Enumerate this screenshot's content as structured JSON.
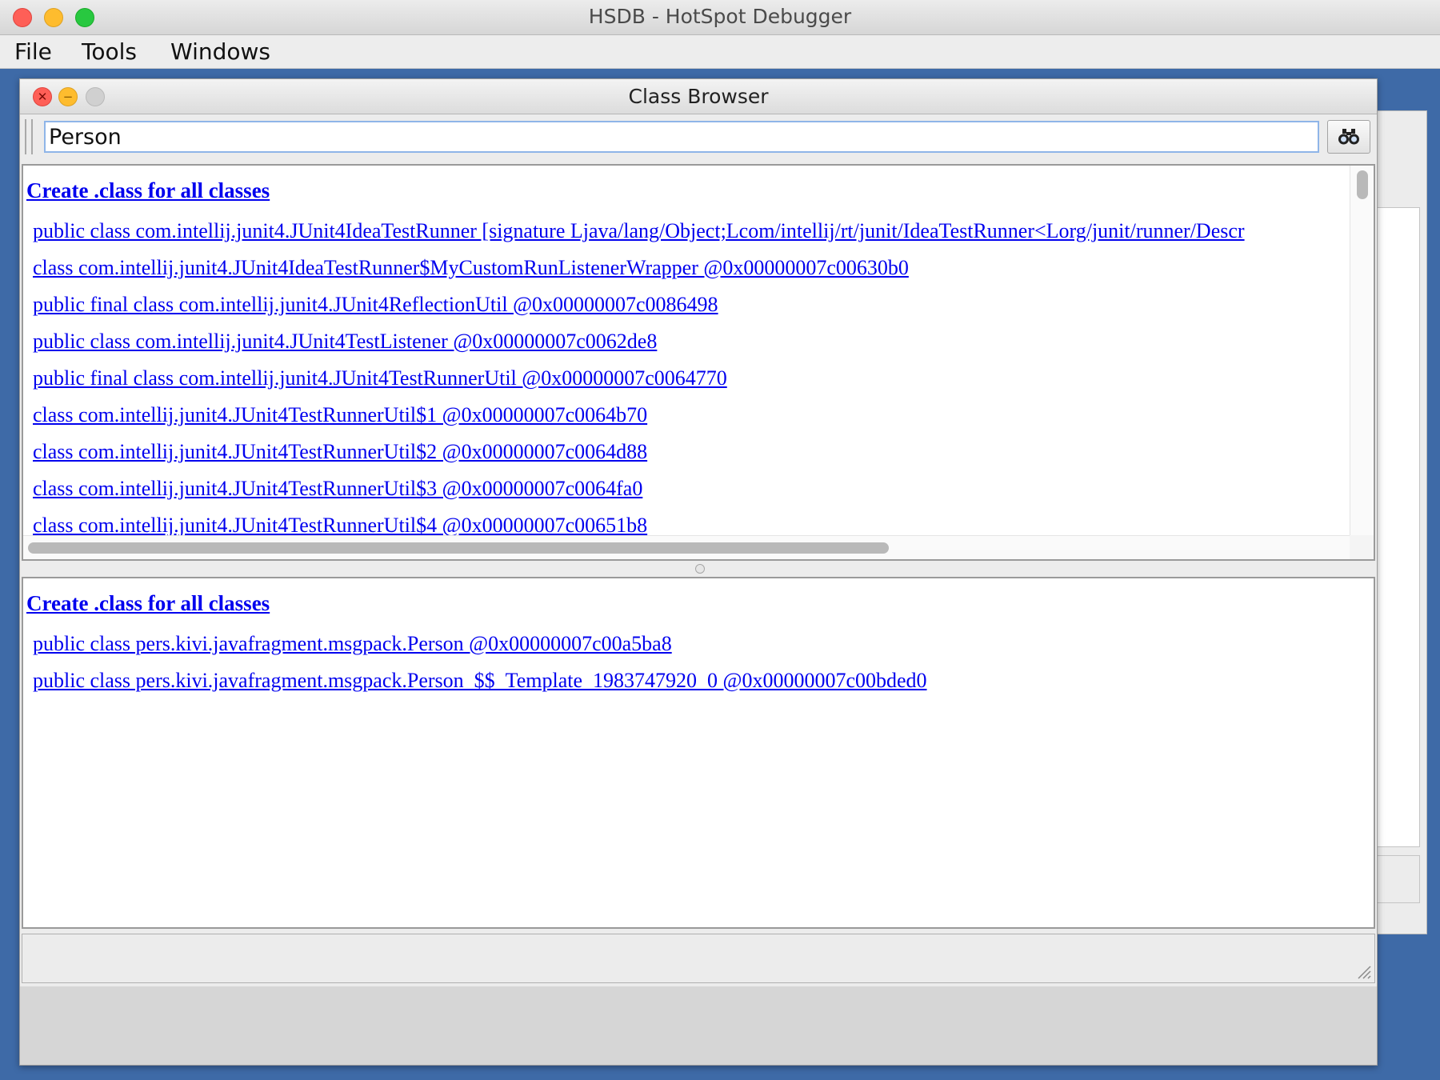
{
  "main_window": {
    "title": "HSDB - HotSpot Debugger",
    "menu": [
      "File",
      "Tools",
      "Windows"
    ],
    "traffic_colors": {
      "close": "#fe5f57",
      "minimize": "#febc2e",
      "zoom": "#28c840"
    }
  },
  "class_browser": {
    "title": "Class Browser",
    "search": {
      "value": "Person",
      "button_icon": "binoculars-icon"
    },
    "top_pane": {
      "create_link": "Create .class for all classes",
      "classes": [
        "public class com.intellij.junit4.JUnit4IdeaTestRunner [signature Ljava/lang/Object;Lcom/intellij/rt/junit/IdeaTestRunner<Lorg/junit/runner/Descr",
        "class com.intellij.junit4.JUnit4IdeaTestRunner$MyCustomRunListenerWrapper @0x00000007c00630b0",
        "public final class com.intellij.junit4.JUnit4ReflectionUtil @0x00000007c0086498",
        "public class com.intellij.junit4.JUnit4TestListener @0x00000007c0062de8",
        "public final class com.intellij.junit4.JUnit4TestRunnerUtil @0x00000007c0064770",
        "class com.intellij.junit4.JUnit4TestRunnerUtil$1 @0x00000007c0064b70",
        "class com.intellij.junit4.JUnit4TestRunnerUtil$2 @0x00000007c0064d88",
        "class com.intellij.junit4.JUnit4TestRunnerUtil$3 @0x00000007c0064fa0",
        "class com.intellij.junit4.JUnit4TestRunnerUtil$4 @0x00000007c00651b8"
      ]
    },
    "bottom_pane": {
      "create_link": "Create .class for all classes",
      "classes": [
        "public class pers.kivi.javafragment.msgpack.Person @0x00000007c00a5ba8",
        "public class pers.kivi.javafragment.msgpack.Person_$$_Template_1983747920_0 @0x00000007c00bded0"
      ]
    },
    "link_color": "#0000ee",
    "button_colors": {
      "close": "#fe5f57",
      "minimize": "#febc2e",
      "zoom": "#d0d0d0"
    }
  }
}
